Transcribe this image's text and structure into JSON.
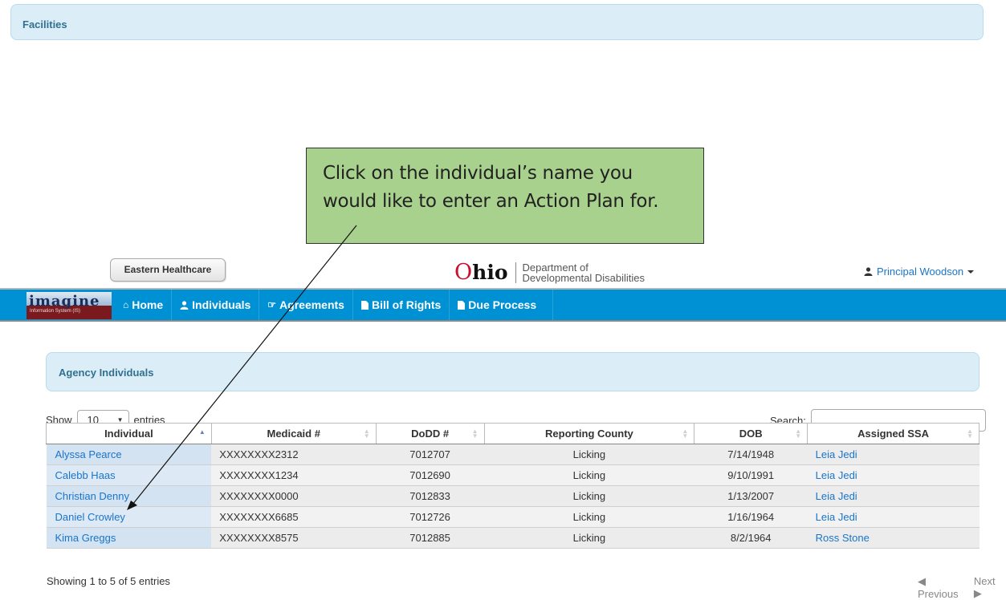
{
  "top_panel": {
    "title": "Facilities"
  },
  "callout": {
    "text": "Click on the individual’s name you would like to enter an Action Plan for."
  },
  "header": {
    "org_button": "Eastern Healthcare",
    "logo": {
      "o": "O",
      "hio": "hio",
      "dept_line1": "Department of",
      "dept_line2": "Developmental Disabilities"
    },
    "user_name": "Principal Woodson"
  },
  "navbar": {
    "brand": {
      "word": "imagine",
      "sub": "Information System (IS)"
    },
    "items": [
      {
        "label": "Home",
        "icon": "home-icon"
      },
      {
        "label": "Individuals",
        "icon": "user-icon"
      },
      {
        "label": "Agreements",
        "icon": "thumbs-up-icon"
      },
      {
        "label": "Bill of Rights",
        "icon": "file-icon"
      },
      {
        "label": "Due Process",
        "icon": "file-icon"
      }
    ]
  },
  "agency_panel": {
    "title": "Agency Individuals"
  },
  "controls": {
    "show": "Show",
    "entries_value": "10",
    "entries": "entries",
    "search_label": "Search:",
    "search_value": ""
  },
  "table": {
    "headers": [
      "Individual",
      "Medicaid #",
      "DoDD #",
      "Reporting County",
      "DOB",
      "Assigned SSA"
    ],
    "rows": [
      [
        "Alyssa Pearce",
        "XXXXXXXX2312",
        "7012707",
        "Licking",
        "7/14/1948",
        "Leia Jedi"
      ],
      [
        "Calebb Haas",
        "XXXXXXXX1234",
        "7012690",
        "Licking",
        "9/10/1991",
        "Leia Jedi"
      ],
      [
        "Christian Denny",
        "XXXXXXXX0000",
        "7012833",
        "Licking",
        "1/13/2007",
        "Leia Jedi"
      ],
      [
        "Daniel Crowley",
        "XXXXXXXX6685",
        "7012726",
        "Licking",
        "1/16/1964",
        "Leia Jedi"
      ],
      [
        "Kima Greggs",
        "XXXXXXXX8575",
        "7012885",
        "Licking",
        "8/2/1964",
        "Ross Stone"
      ]
    ]
  },
  "footer": {
    "info": "Showing 1 to 5 of 5 entries",
    "previous": "Previous",
    "next": "Next"
  },
  "colors": {
    "navbar": "#0091d5",
    "callout": "#a9d18e",
    "panel": "#dbeef7",
    "link": "#1a75c9"
  }
}
